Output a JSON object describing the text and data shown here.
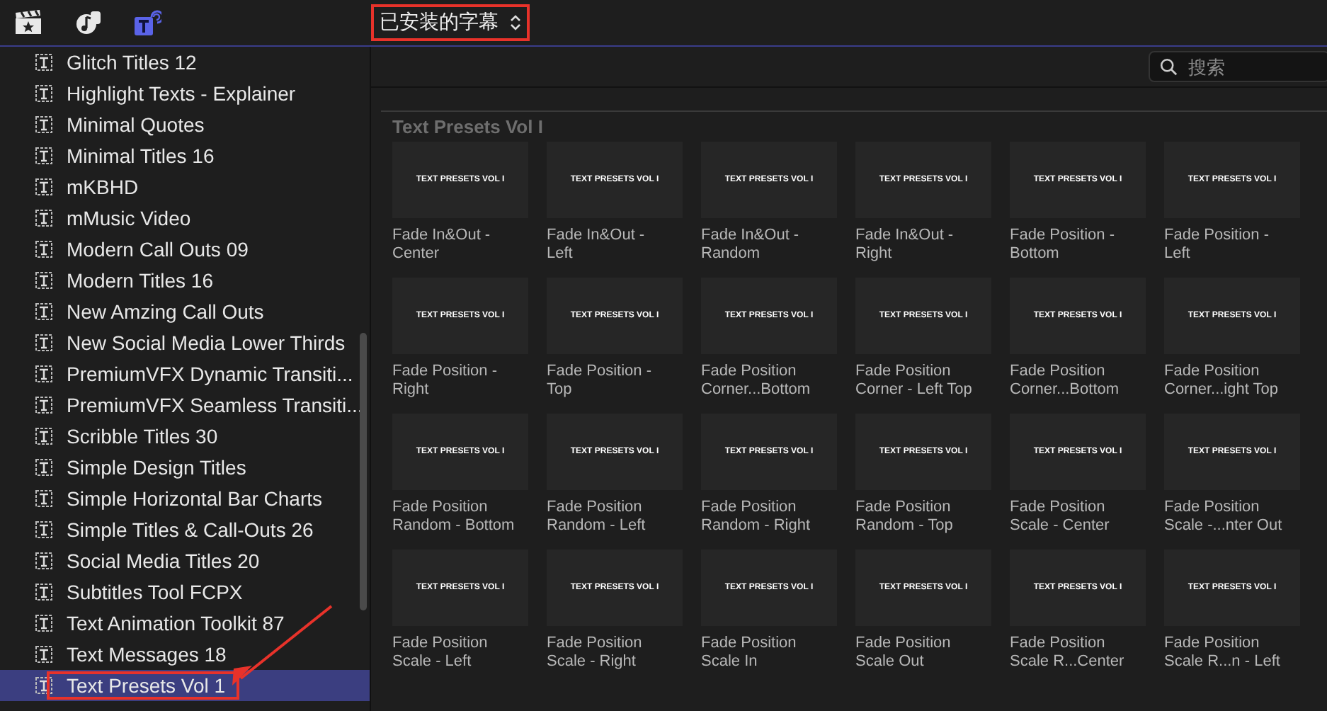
{
  "library_menu": {
    "label": "已安装的字幕",
    "highlighted": true
  },
  "search": {
    "placeholder": "搜索"
  },
  "sidebar": {
    "items": [
      {
        "label": "Glitch Titles 12",
        "selected": false,
        "highlighted": false
      },
      {
        "label": "Highlight Texts - Explainer",
        "selected": false,
        "highlighted": false
      },
      {
        "label": "Minimal Quotes",
        "selected": false,
        "highlighted": false
      },
      {
        "label": "Minimal Titles 16",
        "selected": false,
        "highlighted": false
      },
      {
        "label": "mKBHD",
        "selected": false,
        "highlighted": false
      },
      {
        "label": "mMusic Video",
        "selected": false,
        "highlighted": false
      },
      {
        "label": "Modern Call Outs 09",
        "selected": false,
        "highlighted": false
      },
      {
        "label": "Modern Titles 16",
        "selected": false,
        "highlighted": false
      },
      {
        "label": "New Amzing Call Outs",
        "selected": false,
        "highlighted": false
      },
      {
        "label": "New Social Media Lower Thirds",
        "selected": false,
        "highlighted": false
      },
      {
        "label": "PremiumVFX Dynamic Transiti...",
        "selected": false,
        "highlighted": false
      },
      {
        "label": "PremiumVFX Seamless Transiti...",
        "selected": false,
        "highlighted": false
      },
      {
        "label": "Scribble Titles 30",
        "selected": false,
        "highlighted": false
      },
      {
        "label": "Simple Design Titles",
        "selected": false,
        "highlighted": false
      },
      {
        "label": "Simple Horizontal Bar Charts",
        "selected": false,
        "highlighted": false
      },
      {
        "label": "Simple Titles & Call-Outs 26",
        "selected": false,
        "highlighted": false
      },
      {
        "label": "Social Media Titles 20",
        "selected": false,
        "highlighted": false
      },
      {
        "label": "Subtitles Tool FCPX",
        "selected": false,
        "highlighted": false
      },
      {
        "label": "Text Animation Toolkit 87",
        "selected": false,
        "highlighted": false
      },
      {
        "label": "Text Messages 18",
        "selected": false,
        "highlighted": false
      },
      {
        "label": "Text Presets Vol 1",
        "selected": true,
        "highlighted": true
      }
    ]
  },
  "browser": {
    "section_title": "Text Presets Vol I",
    "items": [
      {
        "thumbnail_text": "TEXT PRESETS VOL I",
        "lines": [
          "Fade In&Out -",
          "Center"
        ]
      },
      {
        "thumbnail_text": "TEXT PRESETS VOL I",
        "lines": [
          "Fade In&Out -",
          "Left"
        ]
      },
      {
        "thumbnail_text": "TEXT PRESETS VOL I",
        "lines": [
          "Fade In&Out -",
          "Random"
        ]
      },
      {
        "thumbnail_text": "TEXT PRESETS VOL I",
        "lines": [
          "Fade In&Out -",
          "Right"
        ]
      },
      {
        "thumbnail_text": "TEXT PRESETS VOL I",
        "lines": [
          "Fade Position -",
          "Bottom"
        ]
      },
      {
        "thumbnail_text": "TEXT PRESETS VOL I",
        "lines": [
          "Fade Position -",
          "Left"
        ]
      },
      {
        "thumbnail_text": "TEXT PRESETS VOL I",
        "lines": [
          "Fade Position -",
          "Right"
        ]
      },
      {
        "thumbnail_text": "TEXT PRESETS VOL I",
        "lines": [
          "Fade Position -",
          "Top"
        ]
      },
      {
        "thumbnail_text": "TEXT PRESETS VOL I",
        "lines": [
          "Fade Position",
          "Corner...Bottom"
        ]
      },
      {
        "thumbnail_text": "TEXT PRESETS VOL I",
        "lines": [
          "Fade Position",
          "Corner - Left Top"
        ]
      },
      {
        "thumbnail_text": "TEXT PRESETS VOL I",
        "lines": [
          "Fade Position",
          "Corner...Bottom"
        ]
      },
      {
        "thumbnail_text": "TEXT PRESETS VOL I",
        "lines": [
          "Fade Position",
          "Corner...ight Top"
        ]
      },
      {
        "thumbnail_text": "TEXT PRESETS VOL I",
        "lines": [
          "Fade Position",
          "Random - Bottom"
        ]
      },
      {
        "thumbnail_text": "TEXT PRESETS VOL I",
        "lines": [
          "Fade Position",
          "Random - Left"
        ]
      },
      {
        "thumbnail_text": "TEXT PRESETS VOL I",
        "lines": [
          "Fade Position",
          "Random - Right"
        ]
      },
      {
        "thumbnail_text": "TEXT PRESETS VOL I",
        "lines": [
          "Fade Position",
          "Random - Top"
        ]
      },
      {
        "thumbnail_text": "TEXT PRESETS VOL I",
        "lines": [
          "Fade Position",
          "Scale - Center"
        ]
      },
      {
        "thumbnail_text": "TEXT PRESETS VOL I",
        "lines": [
          "Fade Position",
          "Scale -...nter Out"
        ]
      },
      {
        "thumbnail_text": "TEXT PRESETS VOL I",
        "lines": [
          "Fade Position",
          "Scale - Left"
        ]
      },
      {
        "thumbnail_text": "TEXT PRESETS VOL I",
        "lines": [
          "Fade Position",
          "Scale - Right"
        ]
      },
      {
        "thumbnail_text": "TEXT PRESETS VOL I",
        "lines": [
          "Fade Position",
          "Scale In"
        ]
      },
      {
        "thumbnail_text": "TEXT PRESETS VOL I",
        "lines": [
          "Fade Position",
          "Scale Out"
        ]
      },
      {
        "thumbnail_text": "TEXT PRESETS VOL I",
        "lines": [
          "Fade Position",
          "Scale R...Center"
        ]
      },
      {
        "thumbnail_text": "TEXT PRESETS VOL I",
        "lines": [
          "Fade Position",
          "Scale R...n - Left"
        ]
      }
    ]
  }
}
